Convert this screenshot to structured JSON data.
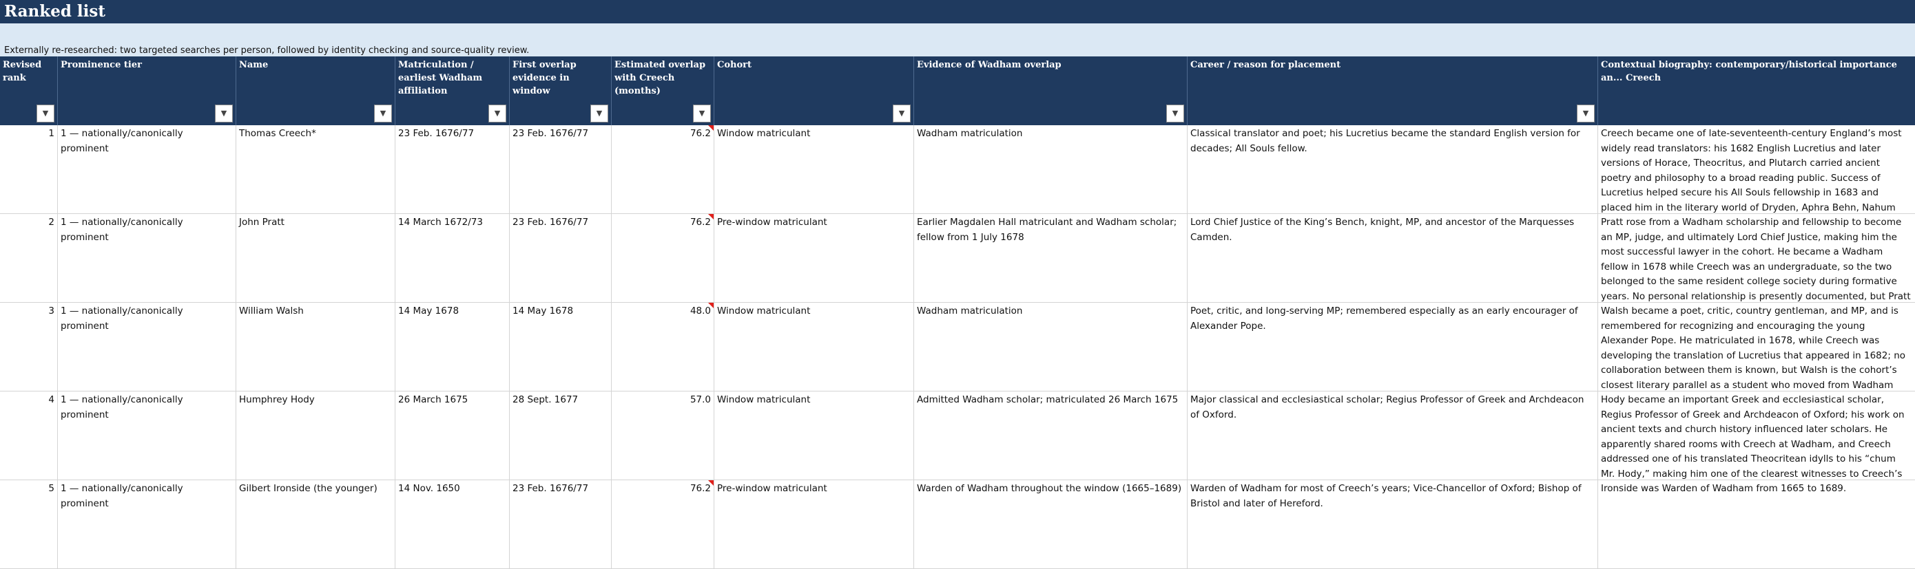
{
  "sheet": {
    "title": "Ranked list",
    "subtitle": "Externally re-researched: two targeted searches per person, followed by identity checking and source-quality review."
  },
  "columns": [
    "Revised rank",
    "Prominence tier",
    "Name",
    "Matriculation / earliest Wadham affiliation",
    "First overlap evidence in window",
    "Estimated overlap with Creech (months)",
    "Cohort",
    "Evidence of Wadham overlap",
    "Career / reason for placement",
    "Contextual biography: contemporary/historical importance an... Creech"
  ],
  "filter_icon": "dropdown-arrow-icon",
  "comment_indicator_color": "#e0201b",
  "rows": [
    {
      "rank": "1",
      "tier": "1 — nationally/canonically prominent",
      "name": "Thomas Creech*",
      "matric": "23 Feb. 1676/77",
      "first_overlap": "23 Feb. 1676/77",
      "months": "76.2",
      "cohort": "Window matriculant",
      "evidence": "Wadham matriculation",
      "career": "Classical translator and poet; his Lucretius became the standard English version for decades; All Souls fellow.",
      "bio": "Creech became one of late-seventeenth-century England’s most widely read translators: his 1682 English Lucretius and later versions of Horace, Theocritus, and Plutarch carried ancient poetry and philosophy to a broad reading public. Success of Lucretius helped secure his All Souls fellowship in 1683 and placed him in the literary world of Dryden, Aphra Behn, Nahum Tate, and other Restoration writers. Wadham friendships, tutors, and performances of university verse are t"
    },
    {
      "rank": "2",
      "tier": "1 — nationally/canonically prominent",
      "name": "John Pratt",
      "matric": "14 March 1672/73",
      "first_overlap": "23 Feb. 1676/77",
      "months": "76.2",
      "cohort": "Pre-window matriculant",
      "evidence": "Earlier Magdalen Hall matriculant and Wadham scholar; fellow from 1 July 1678",
      "career": "Lord Chief Justice of the King’s Bench, knight, MP, and ancestor of the Marquesses Camden.",
      "bio": "Pratt rose from a Wadham scholarship and fellowship to become an MP, judge, and ultimately Lord Chief Justice, making him the most successful lawyer in the cohort. He became a Wadham fellow in 1678 while Creech was an undergraduate, so the two belonged to the same resident college society during formative years. No personal relationship is presently documented, but Pratt illustrates the professional fellowship network surrounding Creech."
    },
    {
      "rank": "3",
      "tier": "1 — nationally/canonically prominent",
      "name": "William Walsh",
      "matric": "14 May 1678",
      "first_overlap": "14 May 1678",
      "months": "48.0",
      "cohort": "Window matriculant",
      "evidence": "Wadham matriculation",
      "career": "Poet, critic, and long-serving MP; remembered especially as an early encourager of Alexander Pope.",
      "bio": "Walsh became a poet, critic, country gentleman, and MP, and is remembered for recognizing and encouraging the young Alexander Pope. He matriculated in 1678, while Creech was developing the translation of Lucretius that appeared in 1682; no collaboration between them is known, but Walsh is the cohort’s closest literary parallel as a student who moved from Wadham into Restoration and early-Augustan literary culture."
    },
    {
      "rank": "4",
      "tier": "1 — nationally/canonically prominent",
      "name": "Humphrey Hody",
      "matric": "26 March 1675",
      "first_overlap": "28 Sept. 1677",
      "months": "57.0",
      "cohort": "Window matriculant",
      "evidence": "Admitted Wadham scholar; matriculated 26 March 1675",
      "career": "Major classical and ecclesiastical scholar; Regius Professor of Greek and Archdeacon of Oxford.",
      "bio": "Hody became an important Greek and ecclesiastical scholar, Regius Professor of Greek and Archdeacon of Oxford; his work on ancient texts and church history influenced later scholars. He apparently shared rooms with Creech at Wadham, and Creech addressed one of his translated Theocritean idylls to his “chum Mr. Hody,” making him one of the clearest witnesses to Creech’s intimate undergraduate life and learning."
    },
    {
      "rank": "5",
      "tier": "1 — nationally/canonically prominent",
      "name": "Gilbert Ironside (the younger)",
      "matric": "14 Nov. 1650",
      "first_overlap": "23 Feb. 1676/77",
      "months": "76.2",
      "cohort": "Pre-window matriculant",
      "evidence": "Warden of Wadham throughout the window (1665–1689)",
      "career": "Warden of Wadham for most of Creech’s years; Vice-Chancellor of Oxford; Bishop of Bristol and later of Hereford.",
      "bio": "Ironside was Warden of Wadham from 1665 to 1689."
    }
  ]
}
